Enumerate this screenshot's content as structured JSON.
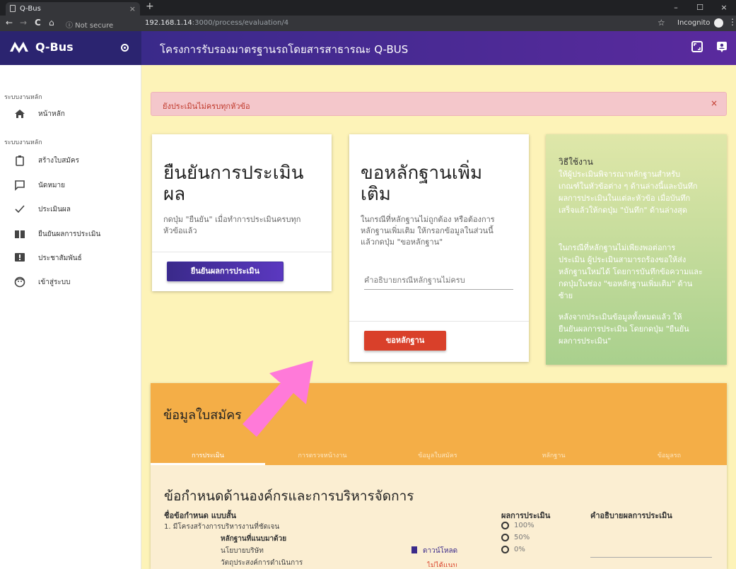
{
  "browser": {
    "tab_title": "Q-Bus",
    "tab_close": "×",
    "new_tab": "+",
    "nav": {
      "back": "←",
      "forward": "→",
      "reload": "C",
      "home": "⌂"
    },
    "security": "ⓘ Not secure",
    "url_host": "192.168.1.14",
    "url_rest": ":3000/process/evaluation/4",
    "star": "☆",
    "incognito": "Incognito",
    "menu": "⋮",
    "window_controls": {
      "minimize": "–",
      "maximize": "☐",
      "close": "×"
    }
  },
  "sidebar": {
    "brand": "Q-Bus",
    "sections": [
      {
        "label": "ระบบงานหลัก",
        "items": [
          {
            "label": "หน้าหลัก",
            "icon": "home-icon"
          }
        ]
      },
      {
        "label": "ระบบงานหลัก",
        "items": [
          {
            "label": "สร้างใบสมัคร",
            "icon": "clipboard-icon"
          },
          {
            "label": "นัดหมาย",
            "icon": "chat-icon"
          },
          {
            "label": "ประเมินผล",
            "icon": "check-icon"
          },
          {
            "label": "ยืนยันผลการประเมิน",
            "icon": "book-icon"
          },
          {
            "label": "ประชาสัมพันธ์",
            "icon": "announce-icon"
          },
          {
            "label": "เข้าสู่ระบบ",
            "icon": "face-icon"
          }
        ]
      }
    ]
  },
  "header": {
    "title": "โครงการรับรองมาตรฐานรถโดยสารสาธารณะ Q-BUS"
  },
  "alert": {
    "message": "ยังประเมินไม่ครบทุกหัวข้อ",
    "close": "×"
  },
  "confirm_card": {
    "title_line1": "ยืนยันการประเมิน",
    "title_line2": "ผล",
    "desc_line1": "กดปุ่ม \"ยืนยัน\" เมื่อทำการประเมินครบทุก",
    "desc_line2": "หัวข้อแล้ว",
    "button": "ยืนยันผลการประเมิน"
  },
  "evidence_card": {
    "title_line1": "ขอหลักฐานเพิ่ม",
    "title_line2": "เติม",
    "desc_line1": "ในกรณีที่หลักฐานไม่ถูกต้อง หรือต้องการ",
    "desc_line2": "หลักฐานเพิ่มเติม ให้กรอกข้อมูลในส่วนนี้",
    "desc_line3": "แล้วกดปุ่ม \"ขอหลักฐาน\"",
    "input_placeholder": "คำอธิบายกรณีหลักฐานไม่ครบ",
    "button": "ขอหลักฐาน"
  },
  "help": {
    "title": "วิธีใช้งาน",
    "p1": [
      "ให้ผู้ประเมินพิจารณาหลักฐานสำหรับ",
      "เกณฑ์ในหัวข้อต่าง ๆ ด้านล่างนี้และบันทึก",
      "ผลการประเมินในแต่ละหัวข้อ เมื่อบันทึก",
      "เสร็จแล้วให้กดปุ่ม \"บันทึก\" ด้านล่างสุด"
    ],
    "p2": [
      "ในกรณีที่หลักฐานไม่เพียงพอต่อการ",
      "ประเมิน ผู้ประเมินสามารถร้องขอให้ส่ง",
      "หลักฐานใหม่ได้ โดยการบันทึกข้อความและ",
      "กดปุ่มในช่อง \"ขอหลักฐานเพิ่มเติม\" ด้าน",
      "ซ้าย"
    ],
    "p3": [
      "หลังจากประเมินข้อมูลทั้งหมดแล้ว ให้",
      "ยืนยันผลการประเมิน โดยกดปุ่ม \"ยืนยัน",
      "ผลการประเมิน\""
    ]
  },
  "application": {
    "title": "ข้อมูลใบสมัคร",
    "tabs": [
      "การประเมิน",
      "การตรวจหน้างาน",
      "ข้อมูลใบสมัคร",
      "หลักฐาน",
      "ข้อมูลรถ"
    ],
    "criteria_title": "ข้อกำหนดด้านองค์กรและการบริหารจัดการ",
    "col_criteria": "ชื่อข้อกำหนด แบบสั้น",
    "col_result": "ผลการประเมิน",
    "col_desc": "คำอธิบายผลการประเมิน",
    "row1": "1. มีโครงสร้างการบริหารงานที่ชัดเจน",
    "evidence_label": "หลักฐานที่แนบมาด้วย",
    "evidence1": "นโยบายบริษัท",
    "evidence2": "วัตถุประสงค์การดำเนินการ",
    "download": "ดาวน์โหลด",
    "not_attached": "ไม่ได้แนบ",
    "options": [
      "100%",
      "50%",
      "0%"
    ]
  },
  "colors": {
    "primary": "#3a2a8a",
    "danger": "#d9402a",
    "accent": "#f4ae47",
    "arrow": "#ff7ad9"
  }
}
